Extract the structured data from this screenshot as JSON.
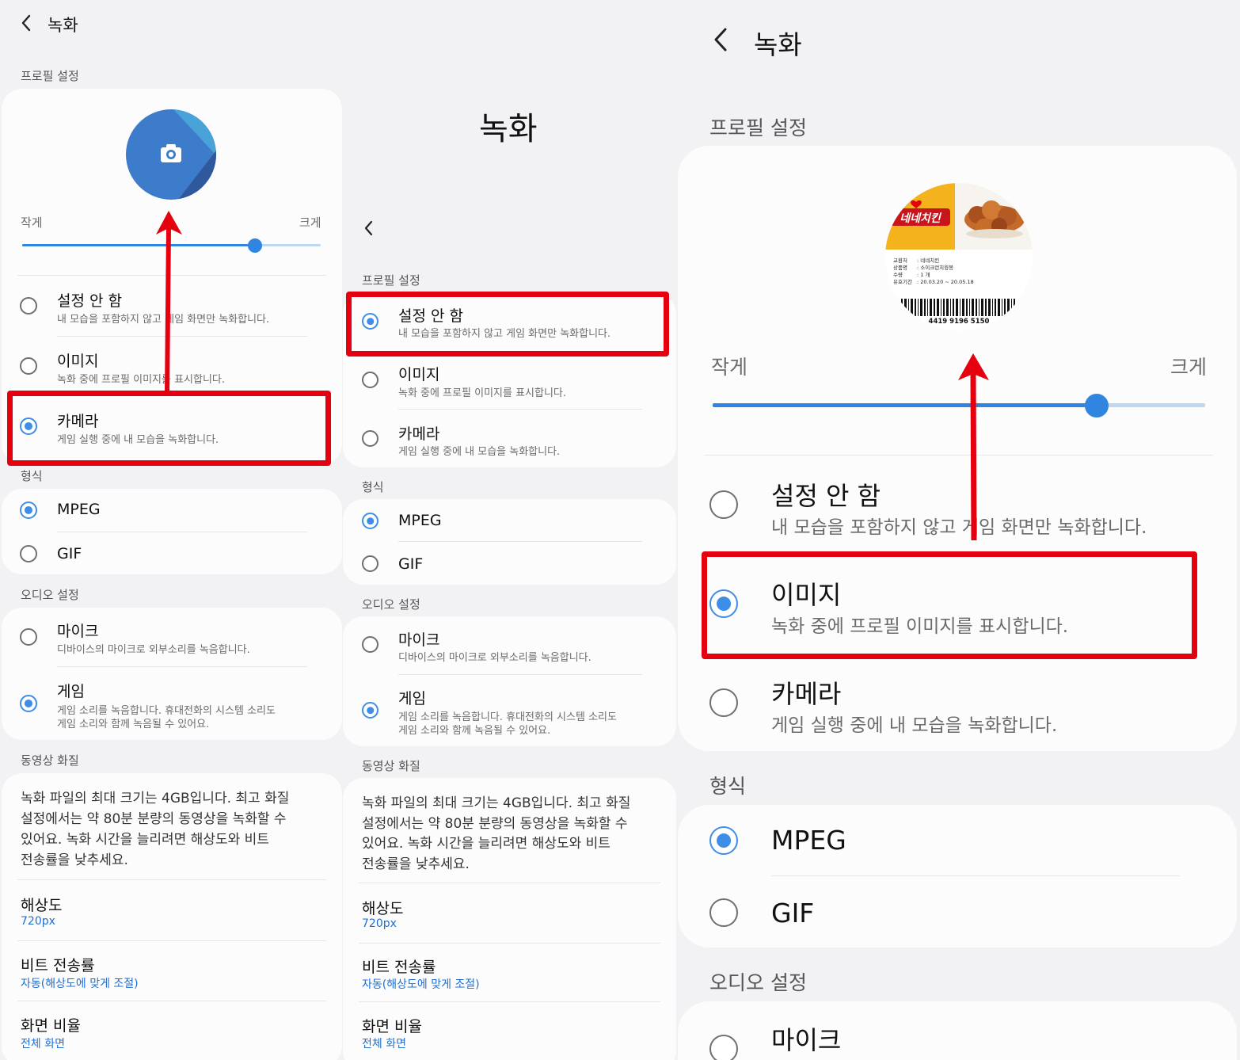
{
  "header": {
    "title": "녹화"
  },
  "sections": {
    "profile": "프로필 설정",
    "format": "형식",
    "audio": "오디오 설정",
    "quality": "동영상 화질"
  },
  "slider": {
    "min_label": "작게",
    "max_label": "크게"
  },
  "profile_options": {
    "none": {
      "label": "설정 안 함",
      "desc": "내 모습을 포함하지 않고 게임 화면만 녹화합니다."
    },
    "image": {
      "label": "이미지",
      "desc": "녹화 중에 프로필 이미지를 표시합니다."
    },
    "camera": {
      "label": "카메라",
      "desc": "게임 실행 중에 내 모습을 녹화합니다."
    }
  },
  "format_options": {
    "mpeg": "MPEG",
    "gif": "GIF"
  },
  "audio_options": {
    "mic": {
      "label": "마이크",
      "desc": "디바이스의 마이크로 외부소리를 녹음합니다."
    },
    "game": {
      "label": "게임",
      "desc1": "게임 소리를 녹음합니다. 휴대전화의 시스템 소리도",
      "desc2": "게임 소리와 함께 녹음될 수 있어요."
    }
  },
  "quality": {
    "info": [
      "녹화 파일의 최대 크기는 4GB입니다. 최고 화질",
      "설정에서는 약 80분 분량의 동영상을 녹화할 수",
      "있어요. 녹화 시간을 늘리려면 해상도와 비트",
      "전송률을 낮추세요."
    ],
    "resolution": {
      "label": "해상도",
      "value": "720px"
    },
    "bitrate": {
      "label": "비트 전송률",
      "value": "자동(해상도에 맞게 조절)"
    },
    "ratio": {
      "label": "화면 비율",
      "value": "전체 화면"
    }
  },
  "gifticon": {
    "brand": "네네치킨",
    "lines": [
      ": 네네치킨",
      ": 소이크런치윙봉",
      ": 1 개",
      ": 20.03.20 ~ 20.05.18"
    ],
    "keys": [
      "교환처",
      "상품명",
      "수량",
      "유효기간"
    ],
    "barcode": "4419 9196 5150"
  },
  "state": {
    "panel1_profile": "camera",
    "panel2_profile": "none",
    "panel3_profile": "image",
    "format": "mpeg",
    "audio": "game"
  },
  "colors": {
    "accent": "#3e8de6",
    "highlight": "#e5000f"
  }
}
